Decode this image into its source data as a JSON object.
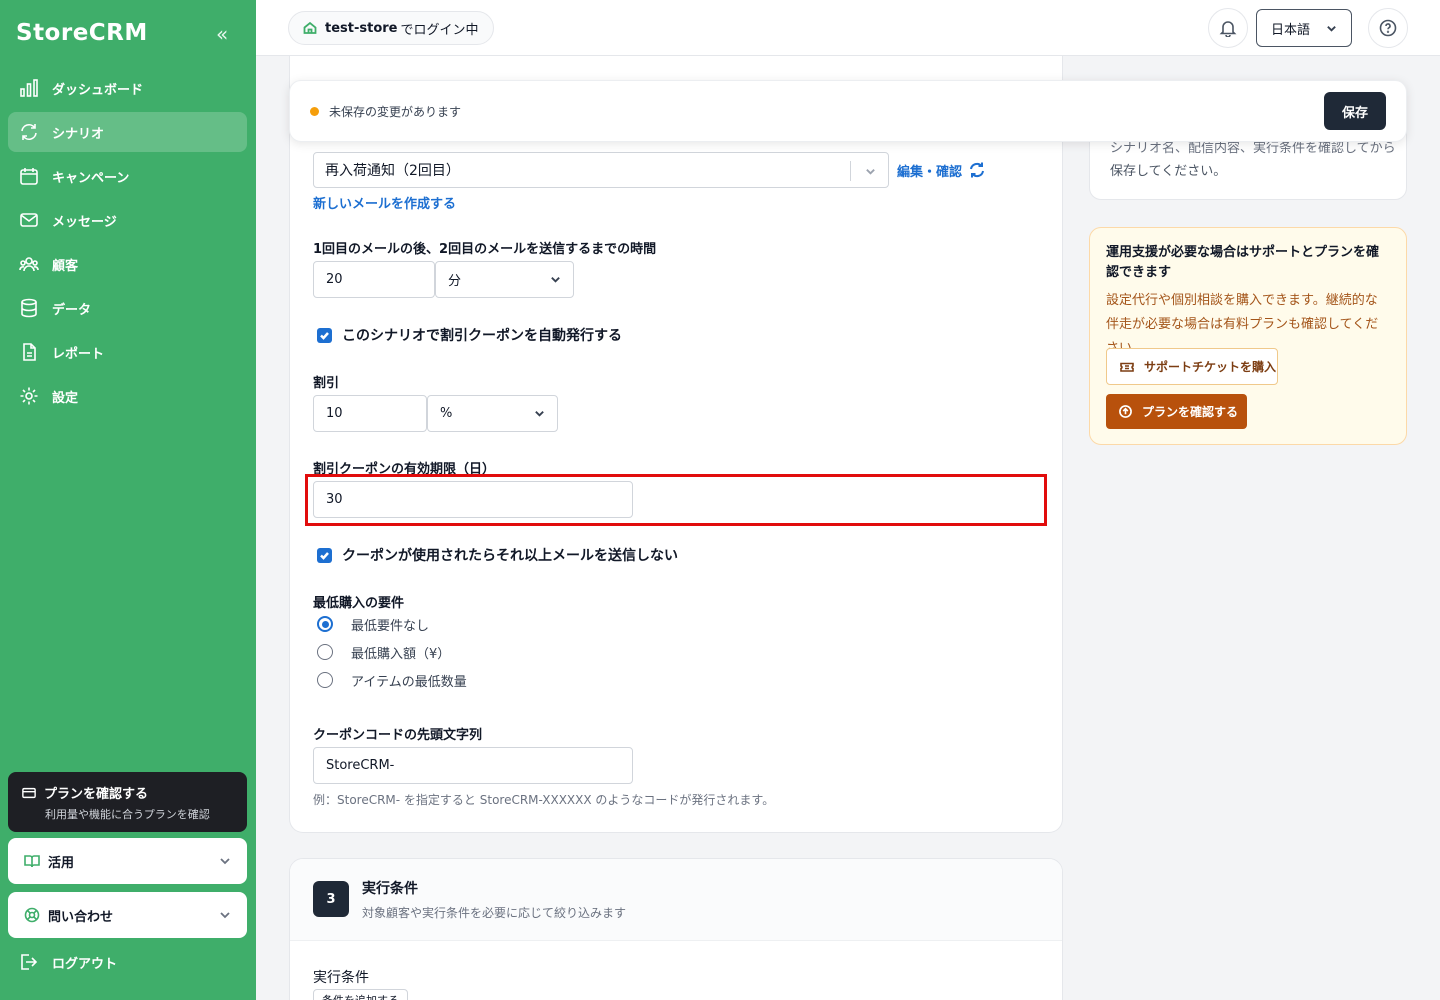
{
  "sidebar": {
    "brand": "StoreCRM",
    "collapse_icon": "double-chevron-left-icon",
    "items": [
      {
        "label": "ダッシュボード",
        "icon": "chart-bar-icon"
      },
      {
        "label": "シナリオ",
        "icon": "refresh-icon",
        "active": true
      },
      {
        "label": "キャンペーン",
        "icon": "calendar-icon"
      },
      {
        "label": "メッセージ",
        "icon": "mail-icon"
      },
      {
        "label": "顧客",
        "icon": "users-icon"
      },
      {
        "label": "データ",
        "icon": "database-icon"
      },
      {
        "label": "レポート",
        "icon": "document-icon"
      },
      {
        "label": "設定",
        "icon": "gear-icon"
      }
    ],
    "plan_card": {
      "title": "プランを確認する",
      "subtitle": "利用量や機能に合うプランを確認"
    },
    "accordion_usage": "活用",
    "accordion_contact": "問い合わせ",
    "logout": "ログアウト"
  },
  "header": {
    "store": "test-store",
    "store_suffix": "でログイン中",
    "language": "日本語"
  },
  "unsaved_bar": {
    "message": "未保存の変更があります",
    "save_label": "保存",
    "status_color": "#f59e0b"
  },
  "form": {
    "email_select_value": "再入荷通知（2回目）",
    "edit_link": "編集・確認",
    "new_email_link": "新しいメールを作成する",
    "delay_label": "1回目のメールの後、2回目のメールを送信するまでの時間",
    "delay_value": "20",
    "delay_unit": "分",
    "coupon_auto_label": "このシナリオで割引クーポンを自動発行する",
    "discount_label": "割引",
    "discount_value": "10",
    "discount_unit": "%",
    "expiry_label": "割引クーポンの有効期限（日）",
    "expiry_value": "30",
    "stop_label": "クーポンが使用されたらそれ以上メールを送信しない",
    "min_purchase_label": "最低購入の要件",
    "min_options": [
      "最低要件なし",
      "最低購入額（¥）",
      "アイテムの最低数量"
    ],
    "prefix_label": "クーポンコードの先頭文字列",
    "prefix_value": "StoreCRM-",
    "prefix_hint": "例：StoreCRM- を指定すると StoreCRM-XXXXXX のようなコードが発行されます。"
  },
  "step3": {
    "number": "3",
    "title": "実行条件",
    "subtitle": "対象顧客や実行条件を必要に応じて絞り込みます",
    "field_label": "実行条件",
    "add_button": "条件を追加する"
  },
  "right_panel": {
    "save_hint_line1": "シナリオ名、配信内容、実行条件を確認してから",
    "save_hint_line2": "保存してください。",
    "support_title": "運用支援が必要な場合はサポートとプランを確認できます",
    "support_body": "設定代行や個別相談を購入できます。継続的な伴走が必要な場合は有料プランも確認してください。",
    "ticket_button": "サポートチケットを購入",
    "plan_button": "プランを確認する"
  },
  "colors": {
    "sidebar": "#3fae6a",
    "accent": "#1d6fd1",
    "highlight": "#e10c0c",
    "support_button": "#b8510c"
  }
}
